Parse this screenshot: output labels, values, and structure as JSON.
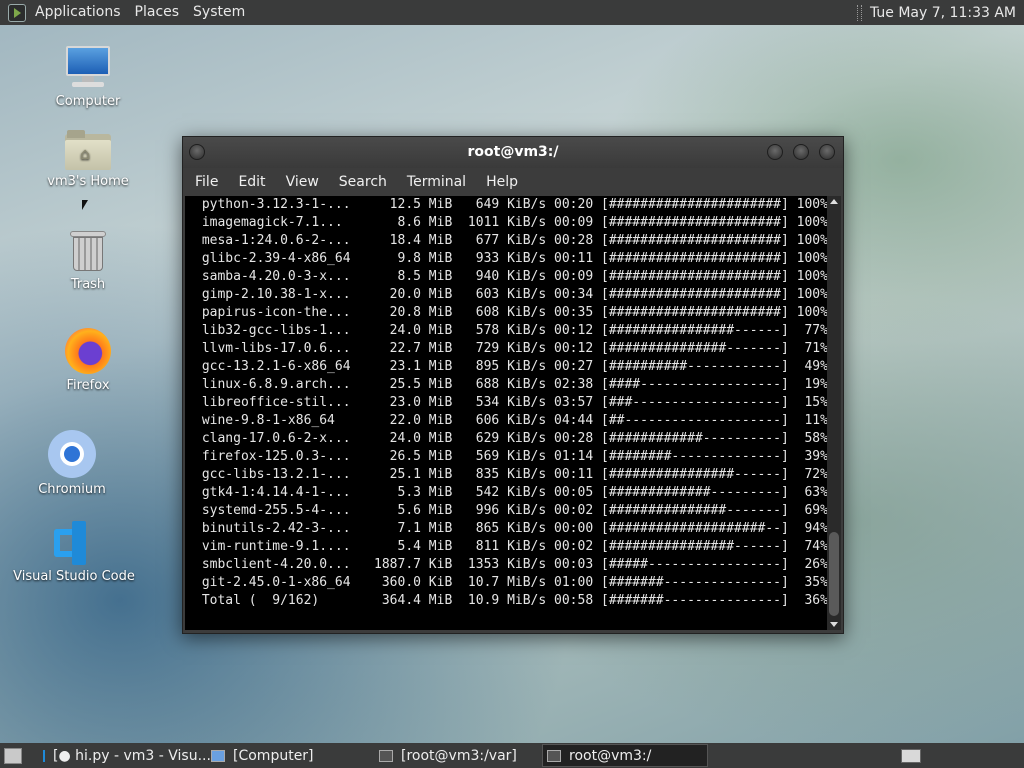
{
  "top_panel": {
    "menus": [
      "Applications",
      "Places",
      "System"
    ],
    "clock": "Tue May  7, 11:33 AM"
  },
  "desktop_icons": [
    {
      "label": "Computer",
      "icon": "computer-icon"
    },
    {
      "label": "vm3's Home",
      "icon": "home-folder-icon"
    },
    {
      "label": "Trash",
      "icon": "trash-icon"
    },
    {
      "label": "Firefox",
      "icon": "firefox-icon"
    },
    {
      "label": "Chromium",
      "icon": "chromium-icon"
    },
    {
      "label": "Visual Studio Code",
      "icon": "vscode-icon"
    }
  ],
  "terminal": {
    "title": "root@vm3:/",
    "menu": [
      "File",
      "Edit",
      "View",
      "Search",
      "Terminal",
      "Help"
    ],
    "lines": [
      " python-3.12.3-1-...     12.5 MiB   649 KiB/s 00:20 [######################] 100%",
      " imagemagick-7.1...       8.6 MiB  1011 KiB/s 00:09 [######################] 100%",
      " mesa-1:24.0.6-2-...     18.4 MiB   677 KiB/s 00:28 [######################] 100%",
      " glibc-2.39-4-x86_64      9.8 MiB   933 KiB/s 00:11 [######################] 100%",
      " samba-4.20.0-3-x...      8.5 MiB   940 KiB/s 00:09 [######################] 100%",
      " gimp-2.10.38-1-x...     20.0 MiB   603 KiB/s 00:34 [######################] 100%",
      " papirus-icon-the...     20.8 MiB   608 KiB/s 00:35 [######################] 100%",
      " lib32-gcc-libs-1...     24.0 MiB   578 KiB/s 00:12 [################------]  77%",
      " llvm-libs-17.0.6...     22.7 MiB   729 KiB/s 00:12 [###############-------]  71%",
      " gcc-13.2.1-6-x86_64     23.1 MiB   895 KiB/s 00:27 [##########------------]  49%",
      " linux-6.8.9.arch...     25.5 MiB   688 KiB/s 02:38 [####------------------]  19%",
      " libreoffice-stil...     23.0 MiB   534 KiB/s 03:57 [###-------------------]  15%",
      " wine-9.8-1-x86_64       22.0 MiB   606 KiB/s 04:44 [##--------------------]  11%",
      " clang-17.0.6-2-x...     24.0 MiB   629 KiB/s 00:28 [############----------]  58%",
      " firefox-125.0.3-...     26.5 MiB   569 KiB/s 01:14 [########--------------]  39%",
      " gcc-libs-13.2.1-...     25.1 MiB   835 KiB/s 00:11 [################------]  72%",
      " gtk4-1:4.14.4-1-...      5.3 MiB   542 KiB/s 00:05 [#############---------]  63%",
      " systemd-255.5-4-...      5.6 MiB   996 KiB/s 00:02 [###############-------]  69%",
      " binutils-2.42-3-...      7.1 MiB   865 KiB/s 00:00 [####################--]  94%",
      " vim-runtime-9.1....      5.4 MiB   811 KiB/s 00:02 [################------]  74%",
      " smbclient-4.20.0...   1887.7 KiB  1353 KiB/s 00:03 [#####-----------------]  26%",
      " git-2.45.0-1-x86_64    360.0 KiB  10.7 MiB/s 01:00 [#######---------------]  35%",
      " Total (  9/162)        364.4 MiB  10.9 MiB/s 00:58 [#######---------------]  36%"
    ]
  },
  "taskbar": [
    {
      "label": "[● hi.py - vm3 - Visu...",
      "icon": "vscode-task-icon",
      "active": false
    },
    {
      "label": "[Computer]",
      "icon": "computer-task-icon",
      "active": false
    },
    {
      "label": "[root@vm3:/var]",
      "icon": "terminal-task-icon",
      "active": false
    },
    {
      "label": "root@vm3:/",
      "icon": "terminal-task-icon",
      "active": true
    }
  ]
}
